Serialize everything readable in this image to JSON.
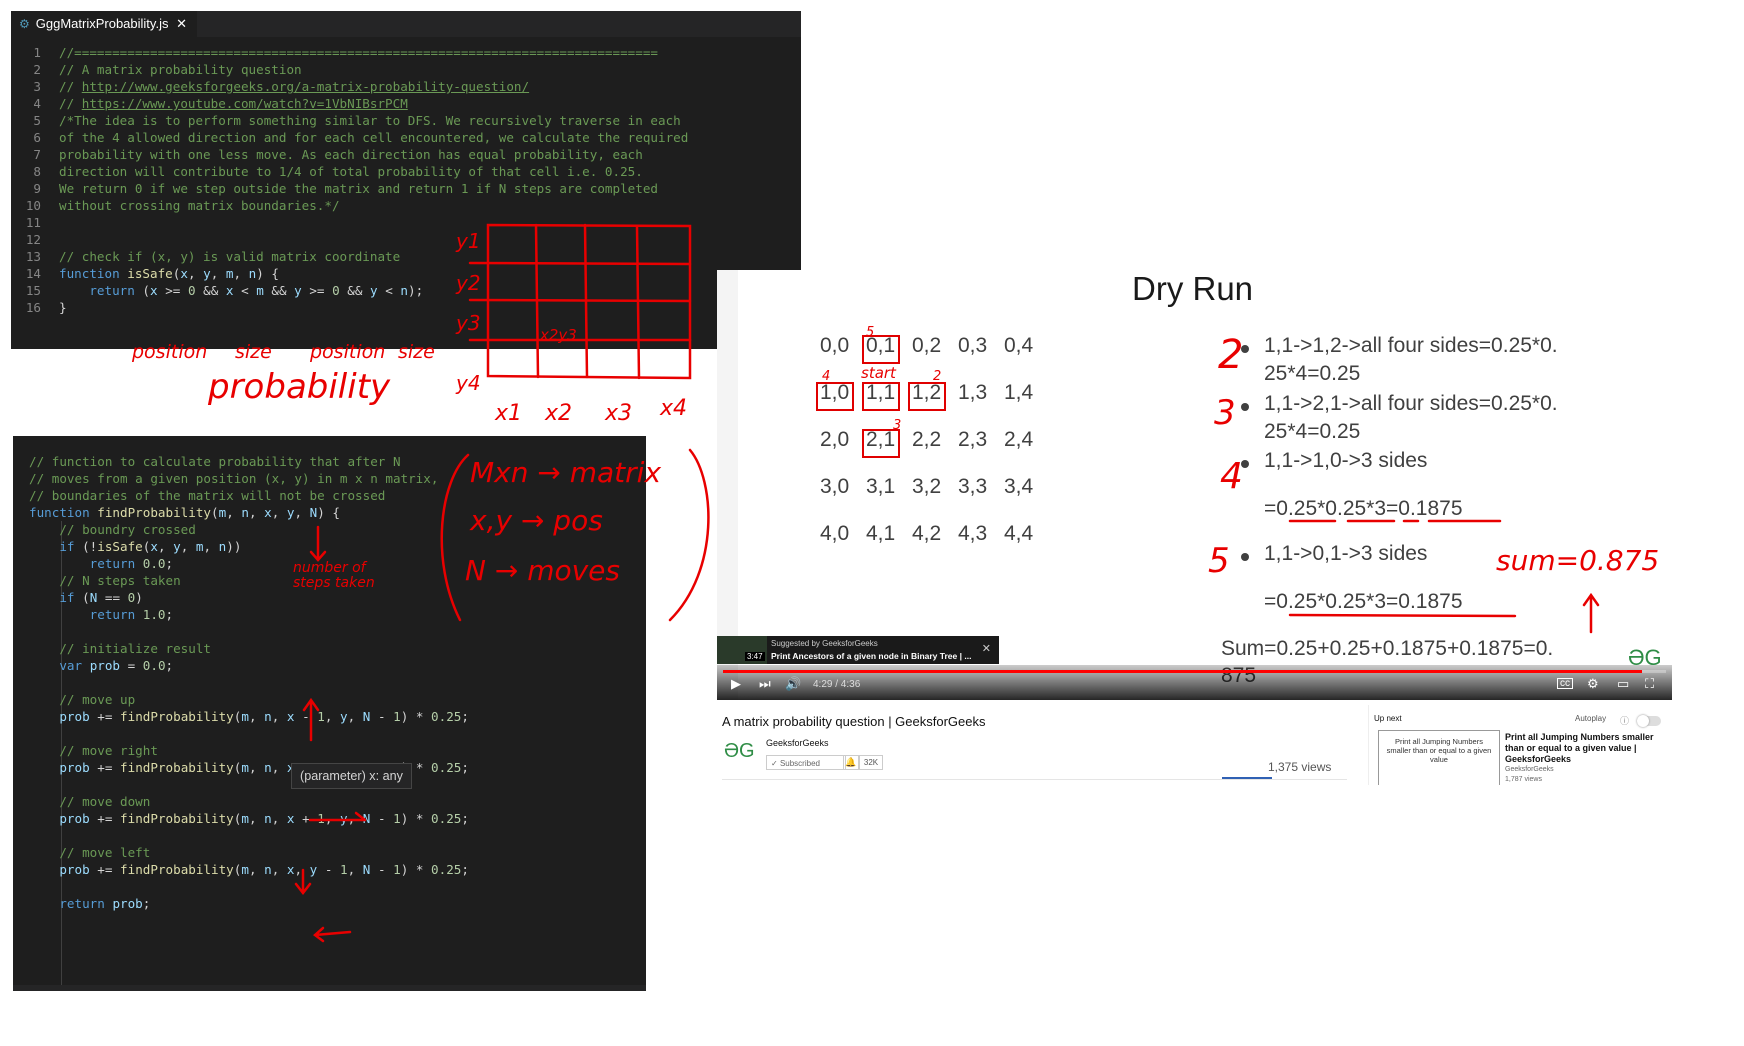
{
  "editor1": {
    "tab_label": "GggMatrixProbability.js",
    "tab_close": "✕",
    "lines": [
      {
        "n": "1",
        "t": "//=============================================================================",
        "cls": "c"
      },
      {
        "n": "2",
        "t": "// A matrix probability question",
        "cls": "c"
      },
      {
        "n": "3",
        "t": "// http://www.geeksforgeeks.org/a-matrix-probability-question/",
        "cls": "c"
      },
      {
        "n": "4",
        "t": "// https://www.youtube.com/watch?v=1VbNIBsrPCM",
        "cls": "c"
      },
      {
        "n": "5",
        "t": "/*The idea is to perform something similar to DFS. We recursively traverse in each",
        "cls": "c"
      },
      {
        "n": "6",
        "t": "of the 4 allowed direction and for each cell encountered, we calculate the required",
        "cls": "c"
      },
      {
        "n": "7",
        "t": "probability with one less move. As each direction has equal probability, each",
        "cls": "c"
      },
      {
        "n": "8",
        "t": "direction will contribute to 1/4 of total probability of that cell i.e. 0.25.",
        "cls": "c"
      },
      {
        "n": "9",
        "t": "We return 0 if we step outside the matrix and return 1 if N steps are completed",
        "cls": "c"
      },
      {
        "n": "10",
        "t": "without crossing matrix boundaries.*/",
        "cls": "c"
      },
      {
        "n": "11",
        "t": "",
        "cls": "c"
      },
      {
        "n": "12",
        "t": "",
        "cls": "c"
      },
      {
        "n": "13",
        "t": "// check if (x, y) is valid matrix coordinate",
        "cls": "c"
      },
      {
        "n": "14",
        "t": "function isSafe(x, y, m, n) {",
        "cls": "code"
      },
      {
        "n": "15",
        "t": "    return (x >= 0 && x < m && y >= 0 && y < n);",
        "cls": "code"
      },
      {
        "n": "16",
        "t": "}",
        "cls": "code"
      }
    ]
  },
  "editor2": {
    "lines": [
      "// function to calculate probability that after N",
      "// moves from a given position (x, y) in m x n matrix,",
      "// boundaries of the matrix will not be crossed",
      "function findProbability(m, n, x, y, N) {",
      "    // boundry crossed",
      "    if (!isSafe(x, y, m, n))",
      "        return 0.0;",
      "    // N steps taken",
      "    if (N == 0)",
      "        return 1.0;",
      "",
      "    // initialize result",
      "    var prob = 0.0;",
      "",
      "    // move up",
      "    prob += findProbability(m, n, x - 1, y, N - 1) * 0.25;",
      "",
      "    // move right",
      "    prob += findProbability(m, n, x, y + 1, N - 1) * 0.25;",
      "",
      "    // move down",
      "    prob += findProbability(m, n, x + 1, y, N - 1) * 0.25;",
      "",
      "    // move left",
      "    prob += findProbability(m, n, x, y - 1, N - 1) * 0.25;",
      "",
      "    return prob;"
    ],
    "hover_tip": "(parameter) x: any"
  },
  "slide": {
    "title": "Dry Run",
    "grid": [
      [
        "0,0",
        "0,1",
        "0,2",
        "0,3",
        "0,4"
      ],
      [
        "1,0",
        "1,1",
        "1,2",
        "1,3",
        "1,4"
      ],
      [
        "2,0",
        "2,1",
        "2,2",
        "2,3",
        "2,4"
      ],
      [
        "3,0",
        "3,1",
        "3,2",
        "3,3",
        "3,4"
      ],
      [
        "4,0",
        "4,1",
        "4,2",
        "4,3",
        "4,4"
      ]
    ],
    "b1a": "1,1->1,2->all four sides=0.25*0.",
    "b1b": "25*4=0.25",
    "b2a": "1,1->2,1->all four sides=0.25*0.",
    "b2b": "25*4=0.25",
    "b3a": "1,1->1,0->3 sides",
    "b3b": "=0.25*0.25*3=0.1875",
    "b4a": "1,1->0,1->3 sides",
    "b4b": "=0.25*0.25*3=0.1875",
    "sum_a": "Sum=0.25+0.25+0.1875+0.1875=0.",
    "sum_b": "875",
    "logo": "ƏG"
  },
  "player": {
    "time": "4:29 / 4:36",
    "progress": 0.975,
    "suggest_label": "Suggested by GeeksforGeeks",
    "suggest_title": "Print Ancestors of a given node in Binary Tree | ...",
    "suggest_duration": "3:47"
  },
  "video_info": {
    "title": "A matrix probability question | GeeksforGeeks",
    "channel": "GeeksforGeeks",
    "subscribed": "Subscribed",
    "sub_count": "32K",
    "views": "1,375 views",
    "logo": "ƏG"
  },
  "up_next": {
    "label": "Up next",
    "autoplay": "Autoplay",
    "thumb_text": "Print all Jumping Numbers smaller than or equal to a given value",
    "title": "Print all Jumping Numbers smaller than or equal to a given value | GeeksforGeeks",
    "channel": "GeeksforGeeks",
    "views": "1,787 views"
  },
  "annotations": {
    "position1": "position",
    "size1": "size",
    "position2": "position",
    "size2": "size",
    "probability": "probability",
    "mxn": "Mxn → matrix",
    "xy": "x,y → pos",
    "nmoves": "N → moves",
    "steps1": "number of",
    "steps2": "steps taken",
    "y1": "y1",
    "y2": "y2",
    "y3": "y3",
    "y4": "y4",
    "x1": "x1",
    "x2": "x2",
    "x3": "x3",
    "x4": "x4",
    "x2y3": "x2y3",
    "start": "start",
    "sum_note": "sum=0.875",
    "n2": "2",
    "n3": "3",
    "n4": "4",
    "n5": "5",
    "sn2": "2",
    "sn3": "3",
    "sn4": "4",
    "sn5": "5"
  }
}
